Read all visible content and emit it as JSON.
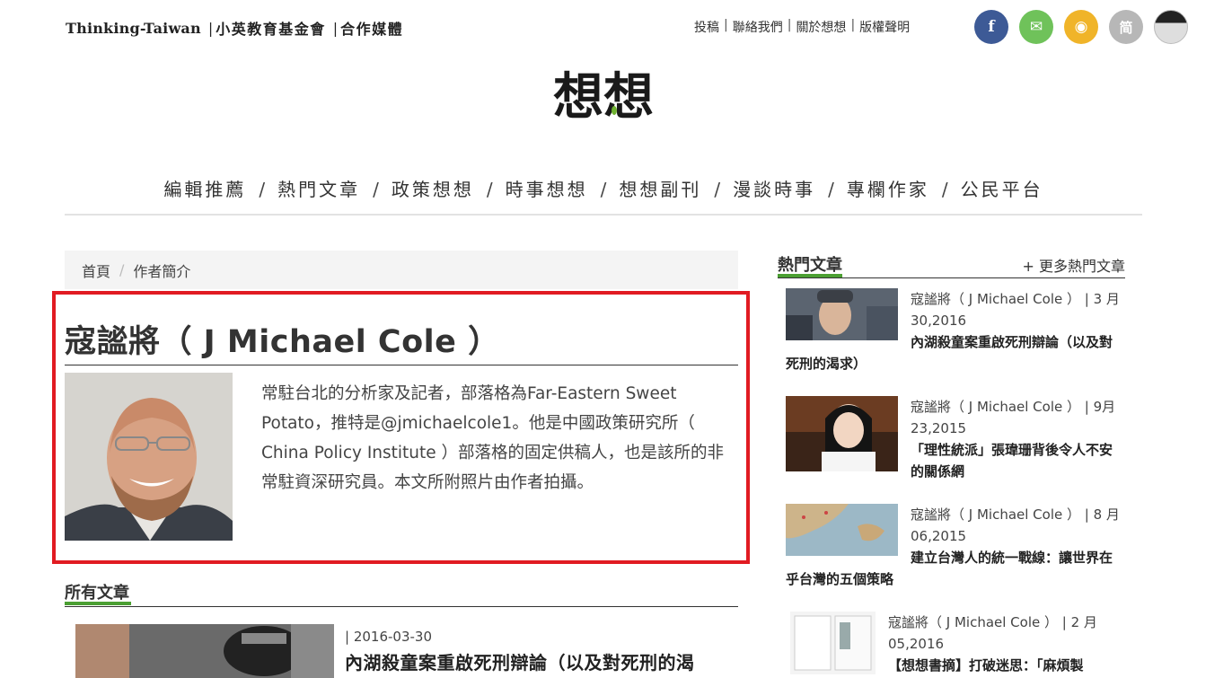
{
  "header": {
    "brand_en": "Thinking-Taiwan",
    "brand_sep1": "|",
    "brand_org": "小英教育基金會",
    "brand_sep2": "|",
    "brand_media": "合作媒體",
    "top_links": [
      "投稿",
      "聯絡我們",
      "關於想想",
      "版權聲明"
    ],
    "top_link_sep": "|",
    "social": [
      {
        "icon": "facebook-icon",
        "glyph": "f",
        "color": "#3d5a96"
      },
      {
        "icon": "mail-icon",
        "glyph": "✉",
        "color": "#6fc25a"
      },
      {
        "icon": "rss-icon",
        "glyph": "◉",
        "color": "#f0b429"
      },
      {
        "icon": "simplified-chinese-icon",
        "glyph": "简",
        "color": "#b7b7b7"
      },
      {
        "icon": "more-icon",
        "glyph": "",
        "color": "#222222"
      }
    ],
    "logo_text": "想想"
  },
  "nav": {
    "items": [
      "編輯推薦",
      "熱門文章",
      "政策想想",
      "時事想想",
      "想想副刊",
      "漫談時事",
      "專欄作家",
      "公民平台"
    ],
    "sep": "/"
  },
  "breadcrumb": {
    "home": "首頁",
    "sep": "/",
    "current": "作者簡介"
  },
  "author": {
    "name": "寇謐將（ J Michael Cole ）",
    "bio": "常駐台北的分析家及記者，部落格為Far-Eastern Sweet Potato，推特是@jmichaelcole1。他是中國政策研究所（ China Policy Institute ）部落格的固定供稿人，也是該所的非常駐資深研究員。本文所附照片由作者拍攝。"
  },
  "all_posts": {
    "heading": "所有文章",
    "items": [
      {
        "date": "| 2016-03-30",
        "title": "內湖殺童案重啟死刑辯論（以及對死刑的渴"
      }
    ]
  },
  "sidebar": {
    "heading": "熱門文章",
    "more": "+ 更多熱門文章",
    "items": [
      {
        "meta": "寇謐將（ J Michael Cole ） | 3 月 30,2016",
        "title": "內湖殺童案重啟死刑辯論（以及對死刑的渴求）"
      },
      {
        "meta": "寇謐將（ J Michael Cole ） | 9月 23,2015",
        "title": "「理性統派」張瑋珊背後令人不安的關係網"
      },
      {
        "meta": "寇謐將（ J Michael Cole ） | 8 月 06,2015",
        "title": "建立台灣人的統一戰線：讓世界在乎台灣的五個策略"
      },
      {
        "meta": "寇謐將（ J Michael Cole ） | 2 月 05,2016",
        "title": "【想想書摘】打破迷思：「麻煩製"
      }
    ]
  },
  "colors": {
    "accent_green": "#4b9f32",
    "highlight_red": "#e11b22"
  }
}
